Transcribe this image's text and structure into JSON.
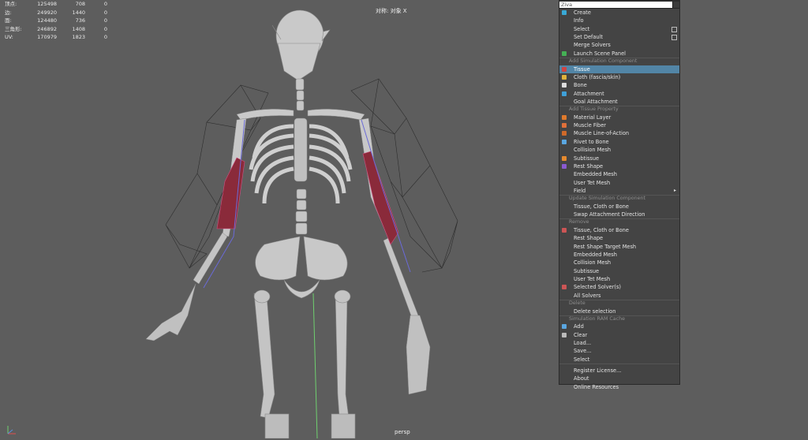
{
  "hud": {
    "rows": [
      {
        "label": "顶点:",
        "v1": "125498",
        "v2": "708",
        "v3": "0"
      },
      {
        "label": "边:",
        "v1": "249920",
        "v2": "1440",
        "v3": "0"
      },
      {
        "label": "面:",
        "v1": "124480",
        "v2": "736",
        "v3": "0"
      },
      {
        "label": "三角形:",
        "v1": "246892",
        "v2": "1408",
        "v3": "0"
      },
      {
        "label": "UV:",
        "v1": "170979",
        "v2": "1823",
        "v3": "0"
      }
    ]
  },
  "viewport": {
    "object_label": "对称: 对象 X",
    "camera_label": "persp"
  },
  "menu": {
    "search_value": "Ziva",
    "groups": [
      {
        "header": "",
        "items": [
          {
            "label": "Create",
            "icon": "ziva-logo-icon",
            "color": "#39a9d6"
          },
          {
            "label": "Info"
          },
          {
            "label": "Select",
            "box": true
          },
          {
            "label": "Set Default",
            "box": true
          },
          {
            "label": "Merge Solvers"
          },
          {
            "label": "Launch Scene Panel",
            "icon": "scene-panel-icon",
            "color": "#45b155"
          }
        ]
      },
      {
        "header": "Add Simulation Component",
        "items": [
          {
            "label": "Tissue",
            "icon": "tissue-icon",
            "color": "#d04444",
            "highlight": true
          },
          {
            "label": "Cloth (fascia/skin)",
            "icon": "cloth-icon",
            "color": "#e0b23c"
          },
          {
            "label": "Bone",
            "icon": "bone-icon",
            "color": "#dddddd"
          },
          {
            "label": "Attachment",
            "icon": "attachment-icon",
            "color": "#3fa0d8"
          },
          {
            "label": "Goal Attachment"
          }
        ]
      },
      {
        "header": "Add Tissue Property",
        "items": [
          {
            "label": "Material Layer",
            "icon": "material-icon",
            "color": "#e07a2c"
          },
          {
            "label": "Muscle Fiber",
            "icon": "fiber-icon",
            "color": "#e0703a"
          },
          {
            "label": "Muscle Line-of-Action",
            "icon": "line-of-action-icon",
            "color": "#d06a2a"
          },
          {
            "label": "Rivet to Bone",
            "icon": "rivet-icon",
            "color": "#5aa6e0"
          },
          {
            "label": "Collision Mesh"
          },
          {
            "label": "Subtissue",
            "icon": "subtissue-icon",
            "color": "#e58a2e"
          },
          {
            "label": "Rest Shape",
            "icon": "rest-shape-icon",
            "color": "#8a5ad0"
          },
          {
            "label": "Embedded Mesh"
          },
          {
            "label": "User Tet Mesh"
          },
          {
            "label": "Field",
            "submenu": true
          }
        ]
      },
      {
        "header": "Update Simulation Component",
        "items": [
          {
            "label": "Tissue, Cloth or Bone"
          },
          {
            "label": "Swap Attachment Direction"
          }
        ]
      },
      {
        "header": "Remove",
        "items": [
          {
            "label": "Tissue, Cloth or Bone",
            "icon": "remove-icon",
            "color": "#cc5555"
          },
          {
            "label": "Rest Shape"
          },
          {
            "label": "Rest Shape Target Mesh"
          },
          {
            "label": "Embedded Mesh"
          },
          {
            "label": "Collision Mesh"
          },
          {
            "label": "Subtissue"
          },
          {
            "label": "User Tet Mesh"
          },
          {
            "label": "Selected Solver(s)",
            "icon": "remove-solver-icon",
            "color": "#cc5555"
          },
          {
            "label": "All Solvers"
          }
        ]
      },
      {
        "header": "Delete",
        "items": [
          {
            "label": "Delete selection"
          }
        ]
      },
      {
        "header": "Simulation RAM Cache",
        "items": [
          {
            "label": "Add",
            "icon": "cache-add-icon",
            "color": "#5aa6e0"
          },
          {
            "label": "Clear",
            "icon": "cache-clear-icon",
            "color": "#bbbbbb"
          },
          {
            "label": "Load..."
          },
          {
            "label": "Save..."
          },
          {
            "label": "Select"
          }
        ]
      },
      {
        "header": "",
        "divider": true,
        "items": [
          {
            "label": "Register License..."
          },
          {
            "label": "About"
          },
          {
            "label": "Online Resources"
          }
        ]
      }
    ]
  }
}
